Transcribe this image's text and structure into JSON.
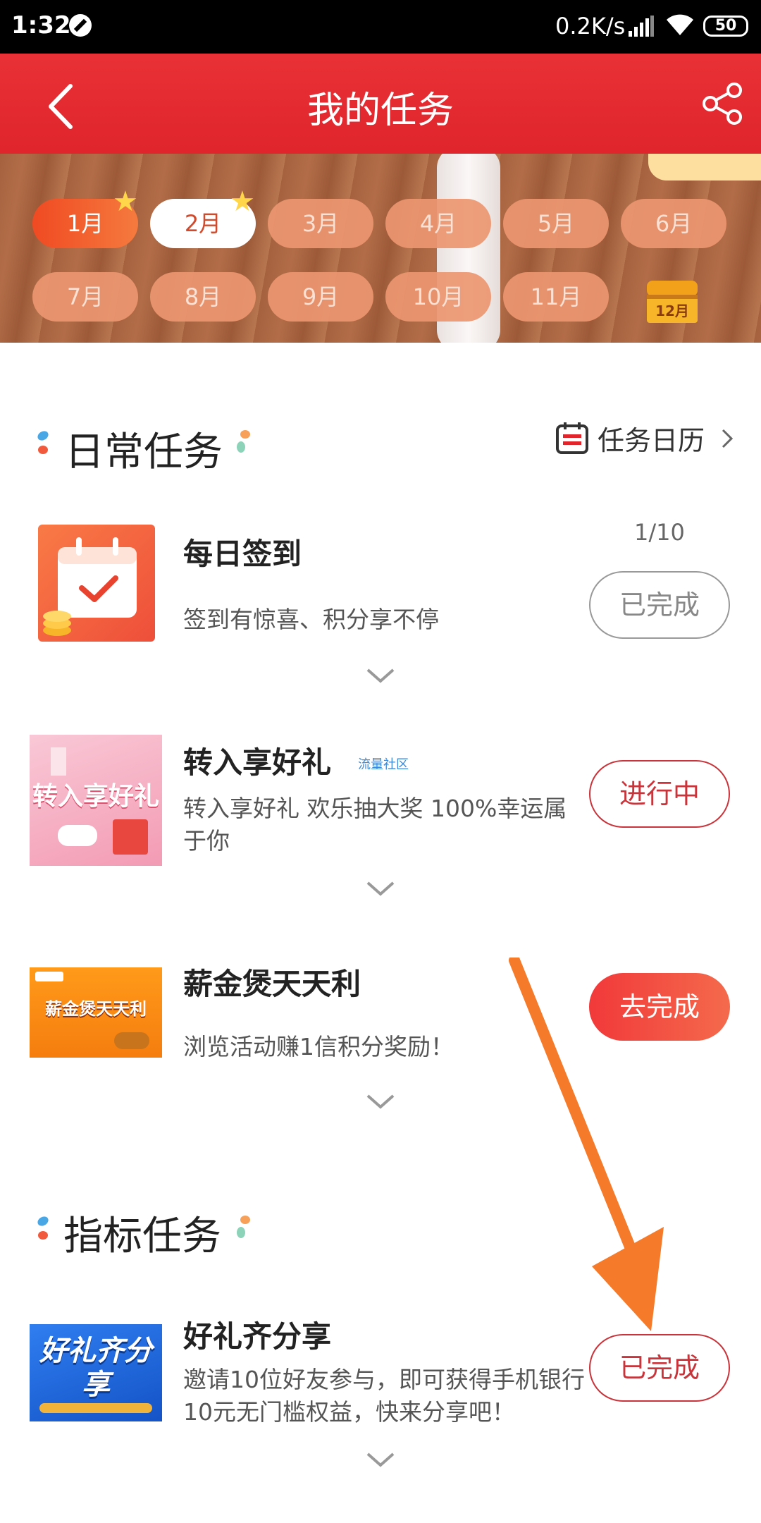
{
  "status_bar": {
    "time": "1:32",
    "speed": "0.2K/s",
    "battery": "50"
  },
  "header": {
    "title": "我的任务"
  },
  "months": {
    "row1": [
      "1月",
      "2月",
      "3月",
      "4月",
      "5月",
      "6月"
    ],
    "row2": [
      "7月",
      "8月",
      "9月",
      "10月",
      "11月"
    ],
    "chest_label": "12月",
    "active": "1月",
    "selected": "2月"
  },
  "daily": {
    "title": "日常任务",
    "calendar_link": "任务日历",
    "tasks": [
      {
        "title": "每日签到",
        "desc": "签到有惊喜、积分享不停",
        "progress": "1/10",
        "button": "已完成"
      },
      {
        "title": "转入享好礼",
        "tag": "流量社区",
        "desc": "转入享好礼 欢乐抽大奖 100%幸运属于你",
        "thumb_text": "转入享好礼",
        "button": "进行中"
      },
      {
        "title": "薪金煲天天利",
        "desc": "浏览活动赚1信积分奖励！",
        "thumb_text": "薪金煲天天利",
        "button": "去完成"
      }
    ]
  },
  "indicator": {
    "title": "指标任务",
    "tasks": [
      {
        "title": "好礼齐分享",
        "desc": "邀请10位好友参与，即可获得手机银行10元无门槛权益，快来分享吧！",
        "thumb_text": "好礼齐分享",
        "button": "已完成"
      }
    ]
  },
  "colors": {
    "brand_red": "#e0252c",
    "highlight_arrow": "#f57a2a"
  }
}
